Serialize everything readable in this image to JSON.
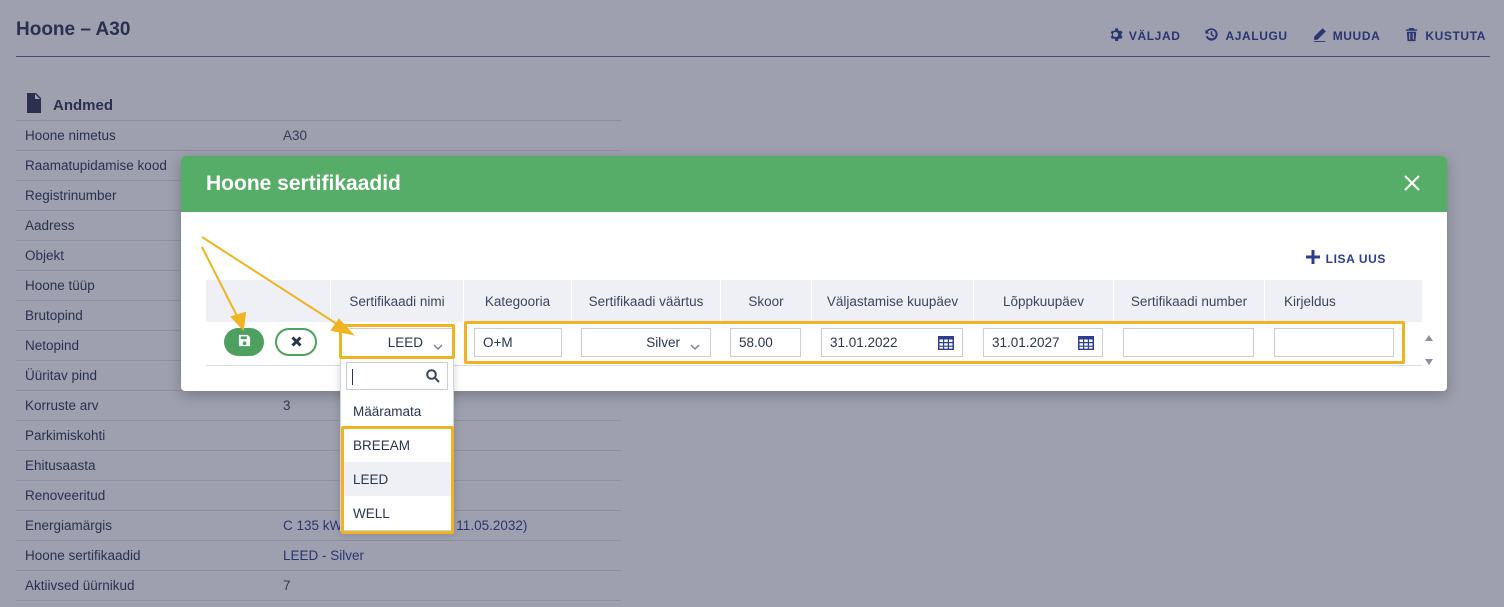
{
  "page": {
    "title": "Hoone – A30",
    "actions": [
      {
        "label": "VÄLJAD",
        "icon": "gear-icon"
      },
      {
        "label": "AJALUGU",
        "icon": "history-icon"
      },
      {
        "label": "MUUDA",
        "icon": "pencil-icon"
      },
      {
        "label": "KUSTUTA",
        "icon": "trash-icon"
      }
    ],
    "section_title": "Andmed",
    "details": [
      {
        "label": "Hoone nimetus",
        "value": "A30"
      },
      {
        "label": "Raamatupidamise kood",
        "value": ""
      },
      {
        "label": "Registrinumber",
        "value": ""
      },
      {
        "label": "Aadress",
        "value": ""
      },
      {
        "label": "Objekt",
        "value": ""
      },
      {
        "label": "Hoone tüüp",
        "value": ""
      },
      {
        "label": "Brutopind",
        "value": ""
      },
      {
        "label": "Netopind",
        "value": ""
      },
      {
        "label": "Üüritav pind",
        "value": ""
      },
      {
        "label": "Korruste arv",
        "value": "3"
      },
      {
        "label": "Parkimiskohti",
        "value": ""
      },
      {
        "label": "Ehitusaasta",
        "value": ""
      },
      {
        "label": "Renoveeritud",
        "value": ""
      },
      {
        "label": "Energiamärgis",
        "value": "C 135 kWh/m² a (kehtiv kuni 11.05.2032)"
      },
      {
        "label": "Hoone sertifikaadid",
        "value": "LEED - Silver"
      },
      {
        "label": "Aktiivsed üürnikud",
        "value": "7"
      }
    ]
  },
  "modal": {
    "title": "Hoone sertifikaadid",
    "add_new_label": "LISA UUS",
    "columns": [
      "Sertifikaadi nimi",
      "Kategooria",
      "Sertifikaadi väärtus",
      "Skoor",
      "Väljastamise kuupäev",
      "Lõppkuupäev",
      "Sertifikaadi number",
      "Kirjeldus"
    ],
    "row": {
      "certificate_name": "LEED",
      "category": "O+M",
      "certificate_value": "Silver",
      "score": "58.00",
      "issue_date": "31.01.2022",
      "end_date": "31.01.2027",
      "certificate_number": "",
      "description": ""
    },
    "dropdown": {
      "search_value": "",
      "options": [
        "Määramata",
        "BREEAM",
        "LEED",
        "WELL"
      ],
      "highlighted": "LEED"
    }
  },
  "colors": {
    "header_green": "#55ad67",
    "accent_blue": "#2d3d8f",
    "highlight": "#f0b323"
  }
}
